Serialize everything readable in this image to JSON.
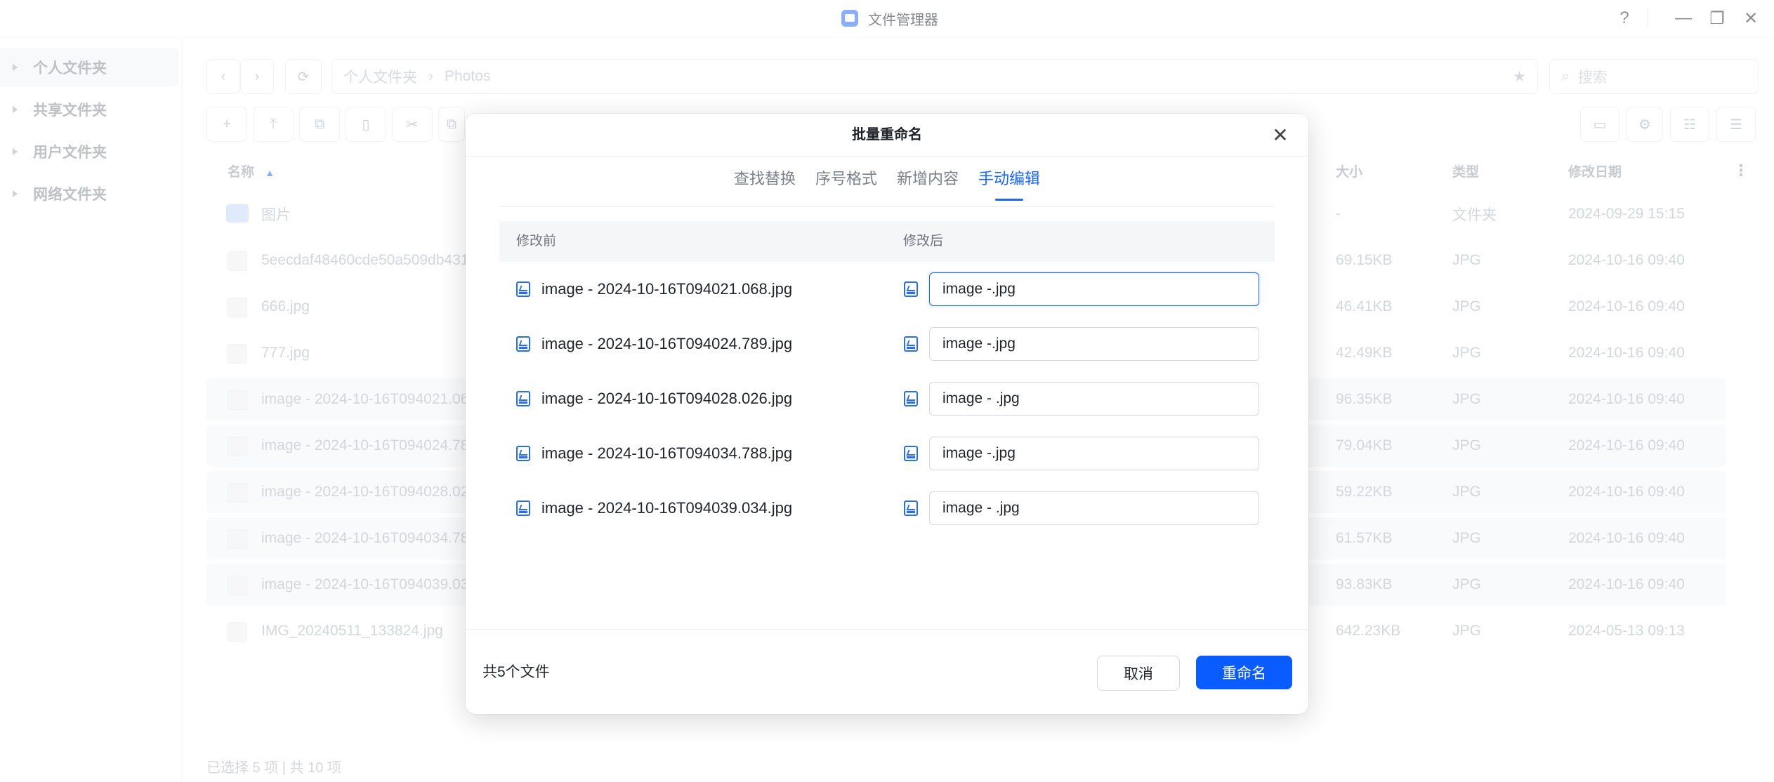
{
  "window": {
    "title": "文件管理器",
    "help": "?",
    "minimize": "—",
    "maximize": "❐",
    "close": "✕"
  },
  "sidebar": {
    "items": [
      {
        "label": "个人文件夹",
        "active": true
      },
      {
        "label": "共享文件夹",
        "active": false
      },
      {
        "label": "用户文件夹",
        "active": false
      },
      {
        "label": "网络文件夹",
        "active": false
      }
    ]
  },
  "nav": {
    "back": "‹",
    "forward": "›",
    "refresh": "⟳",
    "breadcrumb": [
      "个人文件夹",
      "Photos"
    ],
    "breadcrumb_sep": "›",
    "favorite": "★",
    "search_placeholder": "搜索"
  },
  "toolbar": {
    "buttons": [
      "+",
      "⤒",
      "⧉",
      "▯",
      "✂",
      "⧉"
    ],
    "right_buttons": [
      "▭",
      "⚙",
      "☷",
      "☰"
    ]
  },
  "file_table": {
    "headers": {
      "name": "名称",
      "size": "大小",
      "type": "类型",
      "modified": "修改日期",
      "more": "⋮"
    },
    "rows": [
      {
        "name": "图片",
        "size": "-",
        "type": "文件夹",
        "modified": "2024-09-29 15:15",
        "selected": false,
        "folder": true
      },
      {
        "name": "5eecdaf48460cde50a509db431",
        "size": "69.15KB",
        "type": "JPG",
        "modified": "2024-10-16 09:40",
        "selected": false,
        "folder": false
      },
      {
        "name": "666.jpg",
        "size": "46.41KB",
        "type": "JPG",
        "modified": "2024-10-16 09:40",
        "selected": false,
        "folder": false
      },
      {
        "name": "777.jpg",
        "size": "42.49KB",
        "type": "JPG",
        "modified": "2024-10-16 09:40",
        "selected": false,
        "folder": false
      },
      {
        "name": "image - 2024-10-16T094021.06",
        "size": "96.35KB",
        "type": "JPG",
        "modified": "2024-10-16 09:40",
        "selected": true,
        "folder": false
      },
      {
        "name": "image - 2024-10-16T094024.78",
        "size": "79.04KB",
        "type": "JPG",
        "modified": "2024-10-16 09:40",
        "selected": true,
        "folder": false
      },
      {
        "name": "image - 2024-10-16T094028.02",
        "size": "59.22KB",
        "type": "JPG",
        "modified": "2024-10-16 09:40",
        "selected": true,
        "folder": false
      },
      {
        "name": "image - 2024-10-16T094034.78",
        "size": "61.57KB",
        "type": "JPG",
        "modified": "2024-10-16 09:40",
        "selected": true,
        "folder": false
      },
      {
        "name": "image - 2024-10-16T094039.03",
        "size": "93.83KB",
        "type": "JPG",
        "modified": "2024-10-16 09:40",
        "selected": true,
        "folder": false
      },
      {
        "name": "IMG_20240511_133824.jpg",
        "size": "642.23KB",
        "type": "JPG",
        "modified": "2024-05-13 09:13",
        "selected": false,
        "folder": false
      }
    ],
    "status": "已选择 5 项 | 共 10 项"
  },
  "dialog": {
    "title": "批量重命名",
    "close": "✕",
    "tabs": [
      {
        "label": "查找替换",
        "active": false
      },
      {
        "label": "序号格式",
        "active": false
      },
      {
        "label": "新增内容",
        "active": false
      },
      {
        "label": "手动编辑",
        "active": true
      }
    ],
    "columns": {
      "before": "修改前",
      "after": "修改后"
    },
    "rows": [
      {
        "before": "image - 2024-10-16T094021.068.jpg",
        "after": "image -.jpg",
        "focused": true
      },
      {
        "before": "image - 2024-10-16T094024.789.jpg",
        "after": "image -.jpg",
        "focused": false
      },
      {
        "before": "image - 2024-10-16T094028.026.jpg",
        "after": "image - .jpg",
        "focused": false
      },
      {
        "before": "image - 2024-10-16T094034.788.jpg",
        "after": "image -.jpg",
        "focused": false
      },
      {
        "before": "image - 2024-10-16T094039.034.jpg",
        "after": "image - .jpg",
        "focused": false
      }
    ],
    "count": "共5个文件",
    "cancel": "取消",
    "confirm": "重命名"
  },
  "colors": {
    "accent": "#0a5cff",
    "selected_row": "#f4f6f9",
    "muted_text": "#b0b5be"
  }
}
